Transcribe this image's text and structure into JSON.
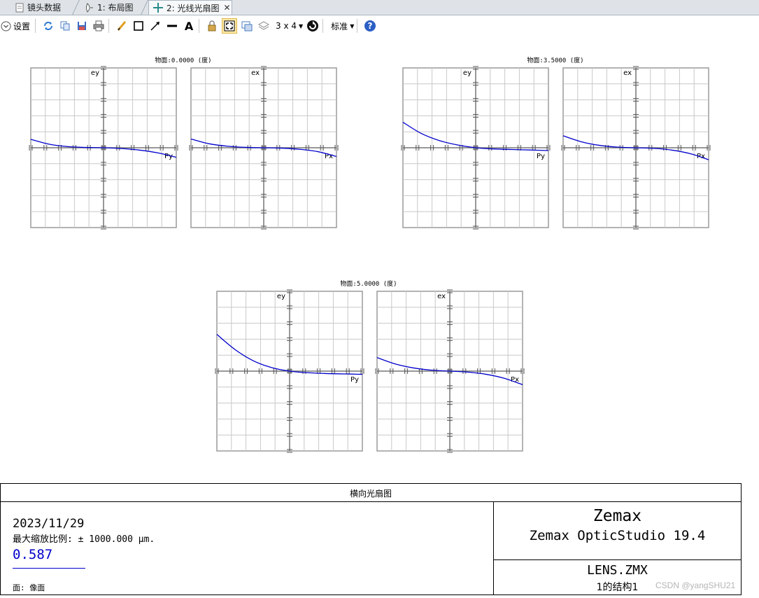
{
  "tabs": [
    {
      "label": "镜头数据",
      "icon": "document-icon"
    },
    {
      "label": "1: 布局图",
      "icon": "lens-icon"
    },
    {
      "label": "2: 光线光扇图",
      "icon": "crosshair-icon",
      "active": true
    }
  ],
  "toolbar": {
    "settings_label": "设置",
    "layout_label": "3 x 4",
    "standard_label": "标准",
    "icons": [
      "refresh-icon",
      "copy-icon",
      "save-icon",
      "print-icon",
      "pencil-icon",
      "rectangle-icon",
      "arrow-icon",
      "line-icon",
      "text-icon",
      "lock-icon",
      "fit-icon",
      "window-icon",
      "layers-icon",
      "rotate-icon",
      "help-icon"
    ]
  },
  "chart_data": {
    "type": "line",
    "curve_color": "#0000cc",
    "grid": true,
    "panels": [
      {
        "field": "物面:0.0000 (度)",
        "charts": [
          {
            "ylabel": "ey",
            "xlabel": "Py",
            "x": [
              -1,
              -0.75,
              -0.5,
              -0.25,
              0,
              0.25,
              0.5,
              0.75,
              1
            ],
            "y": [
              0.105,
              0.045,
              0.015,
              0.004,
              0,
              -0.01,
              -0.03,
              -0.065,
              -0.12
            ]
          },
          {
            "ylabel": "ex",
            "xlabel": "Px",
            "x": [
              -1,
              -0.75,
              -0.5,
              -0.25,
              0,
              0.25,
              0.5,
              0.75,
              1
            ],
            "y": [
              0.11,
              0.05,
              0.02,
              0.005,
              0,
              -0.005,
              -0.02,
              -0.05,
              -0.11
            ]
          }
        ]
      },
      {
        "field": "物面:3.5000 (度)",
        "charts": [
          {
            "ylabel": "ey",
            "xlabel": "Py",
            "x": [
              -1,
              -0.75,
              -0.5,
              -0.25,
              0,
              0.25,
              0.5,
              0.75,
              1
            ],
            "y": [
              0.32,
              0.18,
              0.09,
              0.035,
              0,
              -0.015,
              -0.022,
              -0.028,
              -0.035
            ]
          },
          {
            "ylabel": "ex",
            "xlabel": "Px",
            "x": [
              -1,
              -0.75,
              -0.5,
              -0.25,
              0,
              0.25,
              0.5,
              0.75,
              1
            ],
            "y": [
              0.15,
              0.075,
              0.03,
              0.008,
              0,
              -0.008,
              -0.03,
              -0.075,
              -0.15
            ]
          }
        ]
      },
      {
        "field": "物面:5.0000 (度)",
        "charts": [
          {
            "ylabel": "ey",
            "xlabel": "Py",
            "x": [
              -1,
              -0.75,
              -0.5,
              -0.25,
              0,
              0.25,
              0.5,
              0.75,
              1
            ],
            "y": [
              0.46,
              0.27,
              0.13,
              0.045,
              0,
              -0.02,
              -0.03,
              -0.035,
              -0.04
            ]
          },
          {
            "ylabel": "ex",
            "xlabel": "Px",
            "x": [
              -1,
              -0.75,
              -0.5,
              -0.25,
              0,
              0.25,
              0.5,
              0.75,
              1
            ],
            "y": [
              0.17,
              0.09,
              0.04,
              0.012,
              0,
              -0.012,
              -0.04,
              -0.09,
              -0.17
            ]
          }
        ]
      }
    ],
    "ylim": [
      -1,
      1
    ],
    "xlim": [
      -1,
      1
    ]
  },
  "footer": {
    "title": "横向光扇图",
    "date": "2023/11/29",
    "scale_text": "最大缩放比例: ± 1000.000 μm.",
    "wavelength": "0.587",
    "surface": "面: 像面",
    "company": "Zemax",
    "product": "Zemax OpticStudio 19.4",
    "file": "LENS.ZMX",
    "config": "1的结构1"
  },
  "watermark": "CSDN @yangSHU21"
}
